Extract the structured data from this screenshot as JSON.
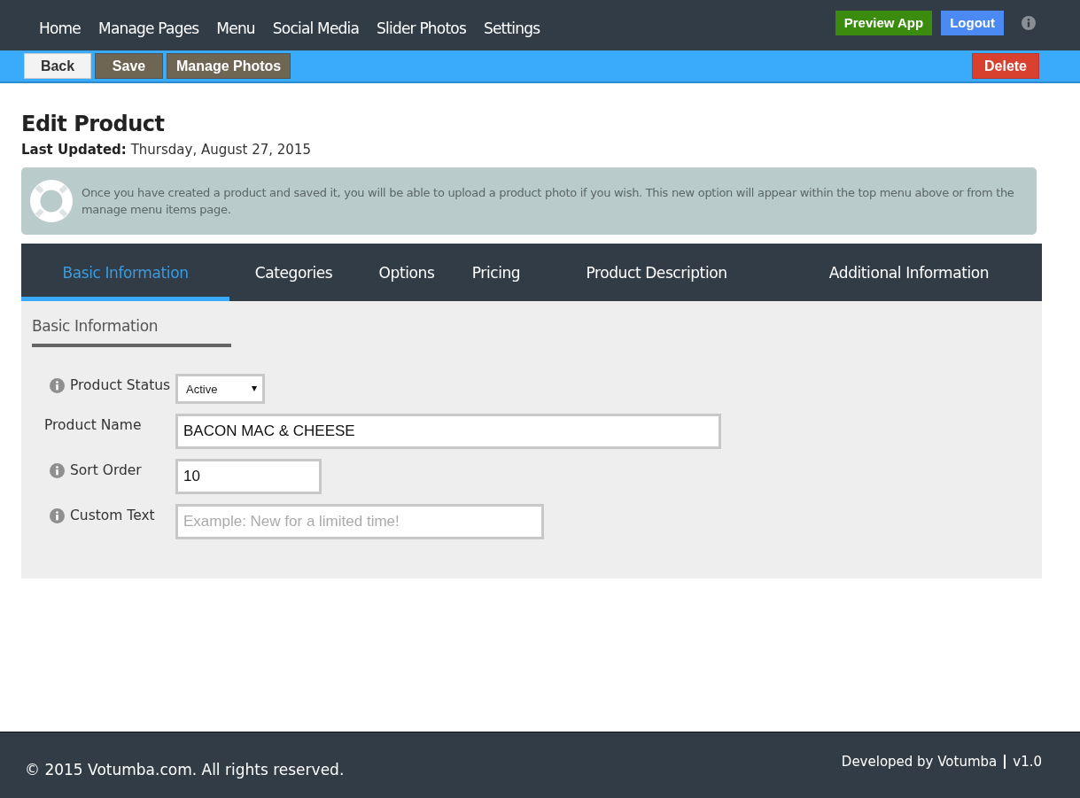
{
  "nav": {
    "items": [
      "Home",
      "Manage Pages",
      "Menu",
      "Social Media",
      "Slider Photos",
      "Settings"
    ],
    "buttons": [
      {
        "label": "Preview App",
        "kind": "success"
      },
      {
        "label": "Logout",
        "kind": "primary"
      }
    ]
  },
  "toolbar": {
    "buttons": [
      {
        "label": "Back",
        "kind": "light"
      },
      {
        "label": "Save",
        "kind": "dark"
      },
      {
        "label": "Manage Photos",
        "kind": "dark"
      }
    ],
    "delete": "Delete"
  },
  "page": {
    "title": "Edit Product",
    "updated_label": "Last Updated:",
    "updated_value": "Thursday, August 27, 2015"
  },
  "notice": "Once you have created a product and saved it, you will be able to upload a product photo if you wish. This new option will appear within the top menu above or from the manage menu items page.",
  "tabs": [
    {
      "label": "Basic Information",
      "selected": true
    },
    {
      "label": "Categories",
      "selected": false
    },
    {
      "label": "Options",
      "selected": false
    },
    {
      "label": "Pricing",
      "selected": false
    },
    {
      "label": "Product Description",
      "selected": false
    },
    {
      "label": "Additional Information",
      "selected": false
    }
  ],
  "section_title": "Basic Information",
  "fields": [
    {
      "label": "Product Status",
      "info": true,
      "kind": "select",
      "value": "Active"
    },
    {
      "label": "Product Name",
      "info": false,
      "kind": "text",
      "value": "BACON MAC & CHEESE"
    },
    {
      "label": "Sort Order",
      "info": true,
      "kind": "text",
      "value": "10"
    },
    {
      "label": "Custom Text",
      "info": true,
      "kind": "text",
      "placeholder": "Example: New for a limited time!"
    }
  ],
  "footer": {
    "copyright": "© 2015 Votumba.com. All rights reserved.",
    "credit": "Developed by Votumba",
    "version": "v1.0"
  }
}
